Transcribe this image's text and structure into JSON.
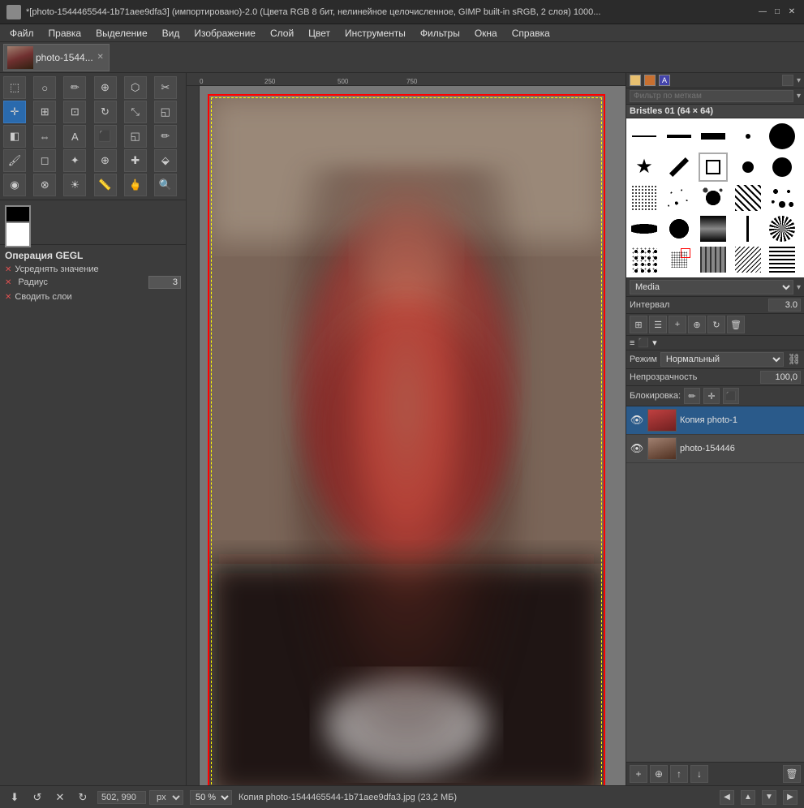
{
  "titlebar": {
    "title": "*[photo-1544465544-1b71aee9dfa3] (импортировано)-2.0 (Цвета RGB 8 бит, нелинейное целочисленное, GIMP built-in sRGB, 2 слоя) 1000...",
    "icon": "gimp-icon",
    "minimize": "—",
    "maximize": "□",
    "close": "✕"
  },
  "menubar": {
    "items": [
      "Файл",
      "Правка",
      "Выделение",
      "Вид",
      "Изображение",
      "Слой",
      "Цвет",
      "Инструменты",
      "Фильтры",
      "Окна",
      "Справка"
    ]
  },
  "tab": {
    "name": "photo-1544...",
    "close": "✕"
  },
  "toolbox": {
    "title": "Операция GEGL",
    "option1_label": "Усреднять значение",
    "option2_label": "Радиус",
    "option2_value": "3",
    "option3_label": "Сводить слои"
  },
  "brushes": {
    "filter_placeholder": "Фильтр по меткам",
    "title": "Bristles 01 (64 × 64)",
    "media_label": "Media",
    "interval_label": "Интервал",
    "interval_value": "3.0"
  },
  "layers": {
    "mode_label": "Режим",
    "mode_value": "Нормальный",
    "opacity_label": "Непрозрачность",
    "opacity_value": "100,0",
    "lock_label": "Блокировка:",
    "layer1_name": "Копия photo-1",
    "layer2_name": "photo-154446"
  },
  "statusbar": {
    "coords": "502, 990",
    "unit": "px",
    "zoom_value": "50 %",
    "info": "Копия photo-1544465544-1b71aee9dfa3.jpg (23,2 МБ)"
  }
}
